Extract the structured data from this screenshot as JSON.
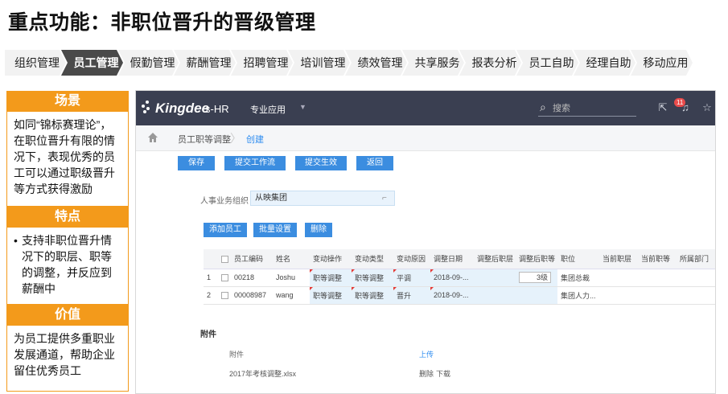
{
  "title": "重点功能：非职位晋升的晋级管理",
  "modules": [
    "组织管理",
    "员工管理",
    "假勤管理",
    "薪酬管理",
    "招聘管理",
    "培训管理",
    "绩效管理",
    "共享服务",
    "报表分析",
    "员工自助",
    "经理自助",
    "移动应用"
  ],
  "active_module": "员工管理",
  "side": {
    "scene_title": "场景",
    "scene_text": "如同“锦标赛理论”，在职位晋升有限的情况下，表现优秀的员工可以通过职级晋升等方式获得激励",
    "feature_title": "特点",
    "feature_text": "支持非职位晋升情况下的职层、职等的调整，并反应到薪酬中",
    "value_title": "价值",
    "value_text": "为员工提供多重职业发展通道，帮助企业留住优秀员工"
  },
  "app": {
    "logo": "Kingdee",
    "product": "s-HR",
    "menu_label": "专业应用",
    "search_placeholder": "搜索",
    "notification_count": "11",
    "breadcrumb": [
      "员工职等调整",
      "创建"
    ],
    "toolbar": [
      "保存",
      "提交工作流",
      "提交生效",
      "返回"
    ],
    "field_label": "人事业务组织",
    "field_value": "从映集团",
    "table_buttons": [
      "添加员工",
      "批量设置",
      "删除"
    ],
    "table": {
      "headers": [
        "",
        "",
        "员工编码",
        "姓名",
        "变动操作",
        "变动类型",
        "变动原因",
        "调整日期",
        "调整后职层",
        "调整后职等",
        "职位",
        "当前职层",
        "当前职等",
        "所属部门"
      ],
      "rows": [
        [
          "1",
          "",
          "00218",
          "Joshu",
          "职等调整",
          "职等调整",
          "平调",
          "2018-09-...",
          "",
          "3级",
          "集团总裁",
          "",
          "",
          ""
        ],
        [
          "2",
          "",
          "00008987",
          "wang",
          "职等调整",
          "职等调整",
          "晋升",
          "2018-09-...",
          "",
          "",
          "集团人力...",
          "",
          "",
          ""
        ]
      ]
    },
    "attachments": {
      "title": "附件",
      "col_name": "附件",
      "col_action": "上传",
      "file": "2017年考核调整.xlsx",
      "delete": "删除",
      "download": "下载"
    }
  },
  "colors": {
    "accent_orange": "#f39a1b",
    "header_dark": "#3a3f51",
    "button_blue": "#3b8de0",
    "active_tab": "#4a4a4a"
  }
}
